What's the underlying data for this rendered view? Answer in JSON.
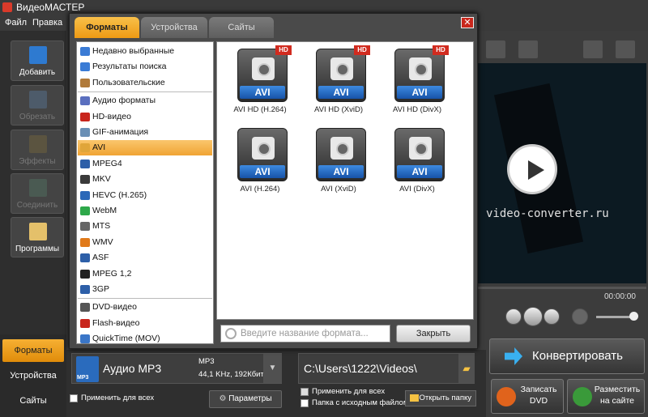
{
  "window": {
    "title": "ВидеоМАСТЕР"
  },
  "menu": [
    "Файл",
    "Правка"
  ],
  "sidebar": {
    "buttons": [
      {
        "label": "Добавить",
        "enabled": true
      },
      {
        "label": "Обрезать",
        "enabled": false
      },
      {
        "label": "Эффекты",
        "enabled": false
      },
      {
        "label": "Соединить",
        "enabled": false
      },
      {
        "label": "Программы",
        "enabled": true
      }
    ]
  },
  "bottom_tabs": [
    {
      "label": "Форматы",
      "active": true
    },
    {
      "label": "Устройства",
      "active": false
    },
    {
      "label": "Сайты",
      "active": false
    }
  ],
  "dialog": {
    "tabs": [
      {
        "label": "Форматы",
        "active": true
      },
      {
        "label": "Устройства",
        "active": false
      },
      {
        "label": "Сайты",
        "active": false
      }
    ],
    "close_label": "✕",
    "categories": [
      {
        "label": "Недавно выбранные",
        "icon": "recent-icon"
      },
      {
        "label": "Результаты поиска",
        "icon": "search-results-icon"
      },
      {
        "label": "Пользовательские",
        "icon": "user-icon"
      },
      {
        "label": "Аудио форматы",
        "icon": "music-note-icon"
      },
      {
        "label": "HD-видео",
        "icon": "hd-icon"
      },
      {
        "label": "GIF-анимация",
        "icon": "gif-icon"
      },
      {
        "label": "AVI",
        "icon": "avi-icon",
        "selected": true
      },
      {
        "label": "MPEG4",
        "icon": "mp4-icon"
      },
      {
        "label": "MKV",
        "icon": "mkv-icon"
      },
      {
        "label": "HEVC (H.265)",
        "icon": "hevc-icon"
      },
      {
        "label": "WebM",
        "icon": "webm-icon"
      },
      {
        "label": "MTS",
        "icon": "mts-icon"
      },
      {
        "label": "WMV",
        "icon": "wmv-icon"
      },
      {
        "label": "ASF",
        "icon": "asf-icon"
      },
      {
        "label": "MPEG 1,2",
        "icon": "mpeg-icon"
      },
      {
        "label": "3GP",
        "icon": "3gp-icon"
      },
      {
        "label": "DVD-видео",
        "icon": "dvd-icon"
      },
      {
        "label": "Flash-видео",
        "icon": "flash-icon"
      },
      {
        "label": "QuickTime (MOV)",
        "icon": "quicktime-icon"
      }
    ],
    "formats": [
      {
        "badge": "AVI",
        "hd": "HD",
        "caption": "AVI HD (H.264)"
      },
      {
        "badge": "AVI",
        "hd": "HD",
        "caption": "AVI HD (XviD)"
      },
      {
        "badge": "AVI",
        "hd": "HD",
        "caption": "AVI HD (DivX)"
      },
      {
        "badge": "AVI",
        "hd": "",
        "caption": "AVI (H.264)"
      },
      {
        "badge": "AVI",
        "hd": "",
        "caption": "AVI (XviD)"
      },
      {
        "badge": "AVI",
        "hd": "",
        "caption": "AVI (DivX)"
      }
    ],
    "search_placeholder": "Введите название формата...",
    "close_button": "Закрыть"
  },
  "preview": {
    "watermark": "video-converter.ru",
    "time": "00:00:00"
  },
  "output": {
    "format_name": "Аудио MP3",
    "format_detail_1": "MP3",
    "format_detail_2": "44,1 KHz, 192Кбит",
    "icon_label": "MP3",
    "apply_all": "Применить для всех",
    "params_button": "Параметры",
    "path": "C:\\Users\\1222\\Videos\\",
    "apply_all_path": "Применить для всех",
    "same_folder": "Папка с исходным файлом",
    "open_folder": "Открыть папку"
  },
  "actions": {
    "convert": "Конвертировать",
    "burn_1": "Записать",
    "burn_2": "DVD",
    "publish_1": "Разместить",
    "publish_2": "на сайте"
  },
  "colors": {
    "accent": "#f0a434",
    "convert_arrow": "#39b0f0"
  }
}
